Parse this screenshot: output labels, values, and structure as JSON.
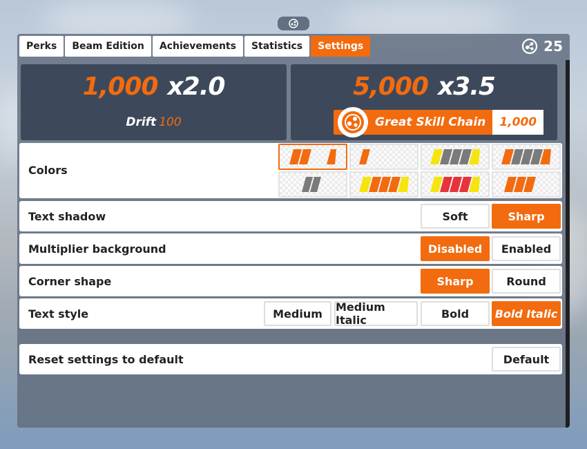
{
  "tabs": [
    {
      "label": "Perks",
      "active": false
    },
    {
      "label": "Beam Edition",
      "active": false
    },
    {
      "label": "Achievements",
      "active": false
    },
    {
      "label": "Statistics",
      "active": false
    },
    {
      "label": "Settings",
      "active": true
    }
  ],
  "points": {
    "value": "25",
    "icon": "skill-points-icon"
  },
  "score_left": {
    "score": "1,000",
    "multiplier": "x2.0",
    "label": "Drift",
    "label_value": "100"
  },
  "score_right": {
    "score": "5,000",
    "multiplier": "x3.5",
    "chain_label": "Great Skill Chain",
    "chain_value": "1,000",
    "chain_icon": "skill-chain-icon"
  },
  "settings": {
    "colors": {
      "label": "Colors",
      "selected_index": 0
    },
    "text_shadow": {
      "label": "Text shadow",
      "options": [
        "Soft",
        "Sharp"
      ],
      "selected": "Sharp"
    },
    "multiplier_background": {
      "label": "Multiplier background",
      "options": [
        "Disabled",
        "Enabled"
      ],
      "selected": "Disabled"
    },
    "corner_shape": {
      "label": "Corner shape",
      "options": [
        "Sharp",
        "Round"
      ],
      "selected": "Sharp"
    },
    "text_style": {
      "label": "Text style",
      "options": [
        "Medium",
        "Medium Italic",
        "Bold",
        "Bold Italic"
      ],
      "selected": "Bold Italic"
    },
    "reset": {
      "label": "Reset settings to default",
      "button": "Default"
    }
  },
  "colors": {
    "accent": "#f26b0f",
    "panel": "#606c7e",
    "score_box": "#344052"
  }
}
